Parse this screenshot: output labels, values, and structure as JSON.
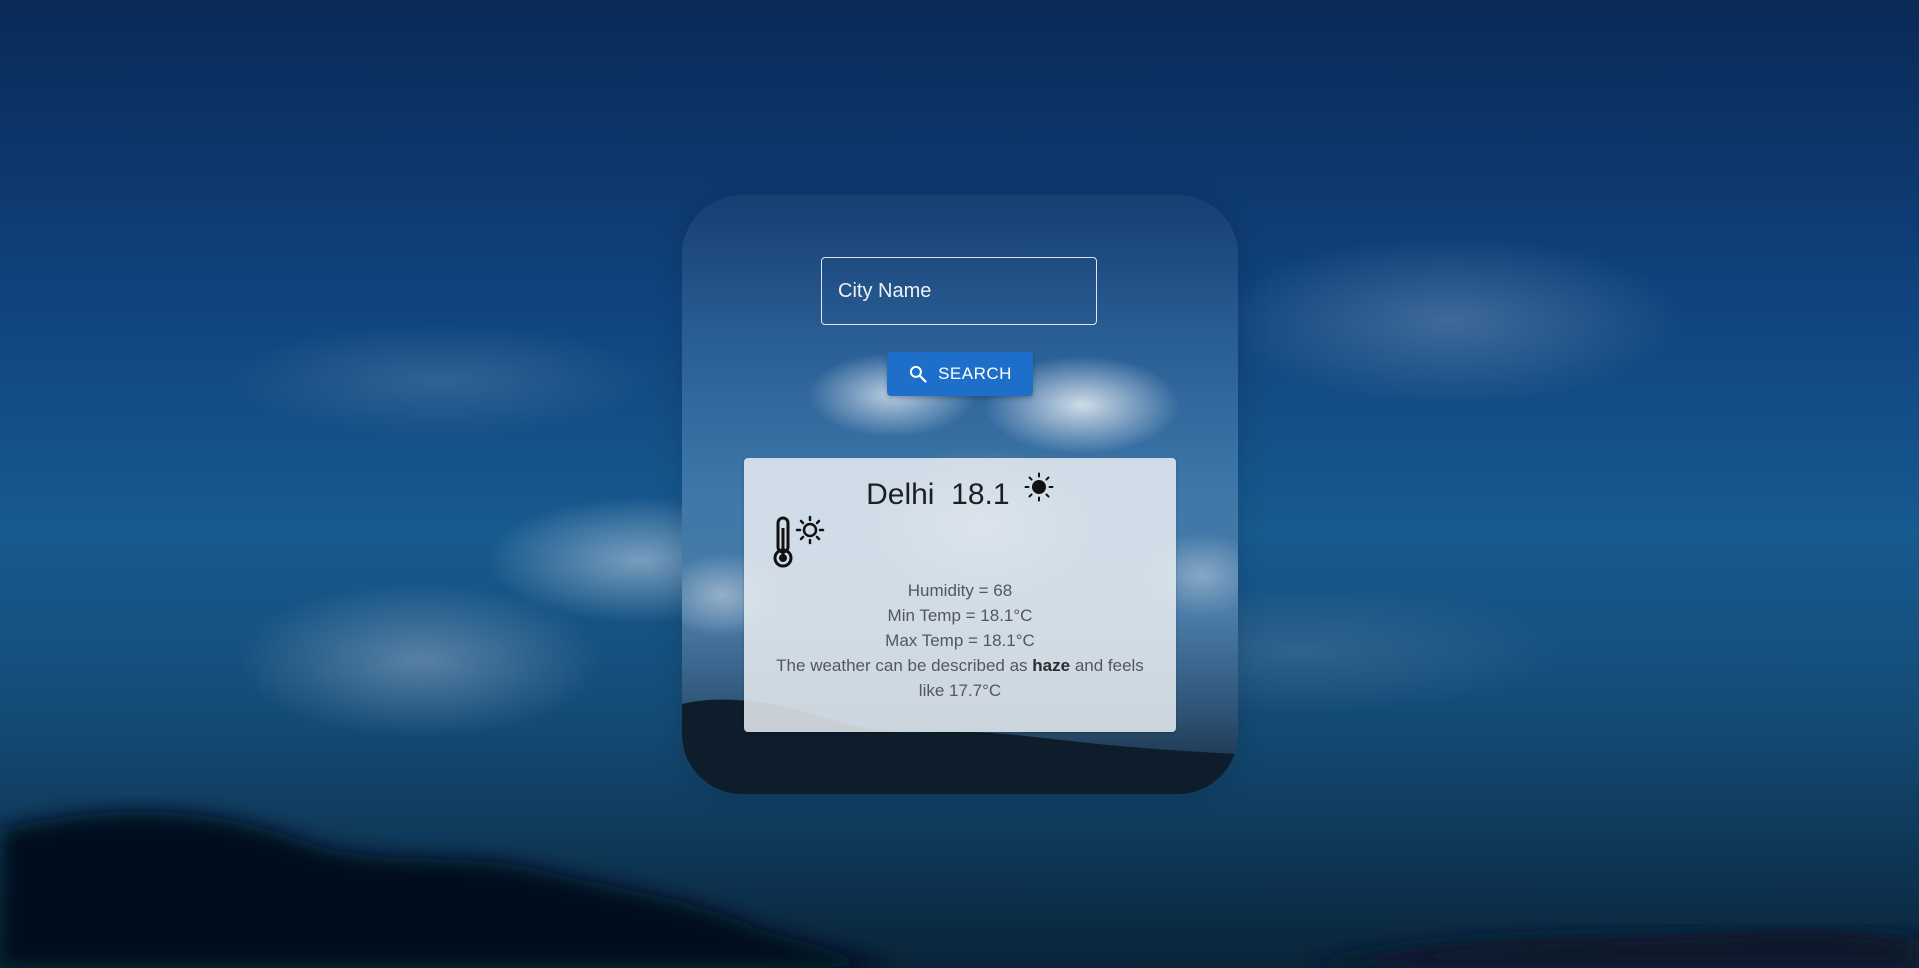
{
  "search": {
    "placeholder": "City Name",
    "button_label": "SEARCH"
  },
  "weather": {
    "city": "Delhi",
    "temperature": "18.1",
    "humidity_text": "Humidity = 68",
    "min_temp_text": "Min Temp = 18.1°C",
    "max_temp_text": "Max Temp = 18.1°C",
    "description_prefix": "The weather can be described as",
    "condition": "haze",
    "description_suffix": "and feels like 17.7°C"
  },
  "icons": {
    "search": "search-icon",
    "sun": "sun-icon",
    "thermometer": "thermometer-sun-icon"
  },
  "colors": {
    "button_bg": "#1e6fc9",
    "info_box_bg": "#e8ecf1",
    "text_dark": "#1d1f22",
    "text_muted": "#54575c"
  }
}
